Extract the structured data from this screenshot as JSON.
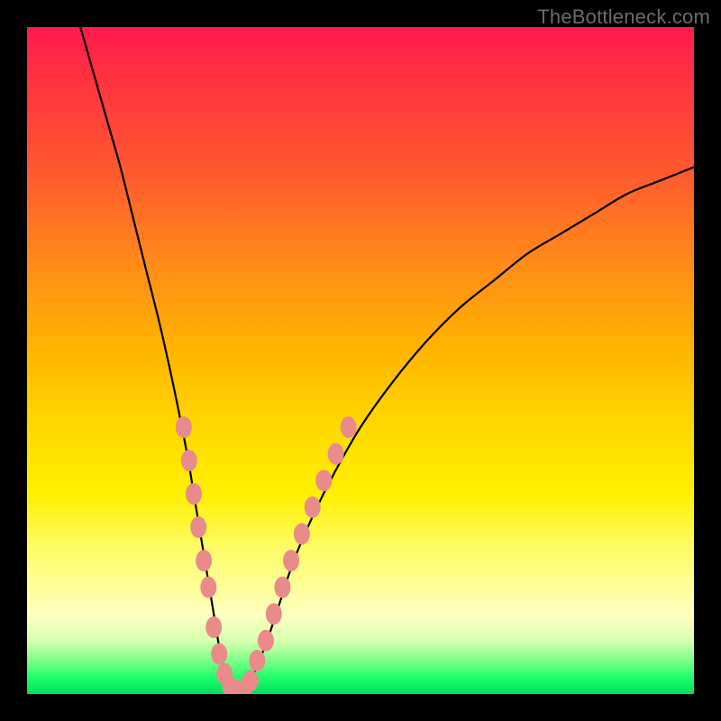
{
  "watermark": "TheBottleneck.com",
  "chart_data": {
    "type": "line",
    "title": "",
    "xlabel": "",
    "ylabel": "",
    "xlim": [
      0,
      100
    ],
    "ylim": [
      0,
      100
    ],
    "series": [
      {
        "name": "bottleneck-curve",
        "x": [
          8,
          10,
          12,
          14,
          16,
          18,
          20,
          22,
          24,
          25,
          26,
          27,
          28,
          29,
          30,
          31,
          32,
          33,
          34,
          36,
          38,
          40,
          43,
          46,
          50,
          55,
          60,
          65,
          70,
          75,
          80,
          85,
          90,
          95,
          100
        ],
        "y": [
          100,
          93,
          86,
          79,
          71,
          63,
          55,
          46,
          36,
          30,
          24,
          18,
          12,
          6,
          2,
          0,
          0,
          1,
          3,
          8,
          14,
          20,
          27,
          33,
          40,
          47,
          53,
          58,
          62,
          66,
          69,
          72,
          75,
          77,
          79
        ]
      }
    ],
    "markers": {
      "name": "highlight-dots",
      "color": "#e98b8b",
      "points": [
        {
          "x": 23.5,
          "y": 40
        },
        {
          "x": 24.3,
          "y": 35
        },
        {
          "x": 25.0,
          "y": 30
        },
        {
          "x": 25.7,
          "y": 25
        },
        {
          "x": 26.5,
          "y": 20
        },
        {
          "x": 27.2,
          "y": 16
        },
        {
          "x": 28.0,
          "y": 10
        },
        {
          "x": 28.8,
          "y": 6
        },
        {
          "x": 29.6,
          "y": 3
        },
        {
          "x": 30.5,
          "y": 1
        },
        {
          "x": 31.5,
          "y": 0.5
        },
        {
          "x": 32.5,
          "y": 0.5
        },
        {
          "x": 33.5,
          "y": 2
        },
        {
          "x": 34.5,
          "y": 5
        },
        {
          "x": 35.8,
          "y": 8
        },
        {
          "x": 37.0,
          "y": 12
        },
        {
          "x": 38.3,
          "y": 16
        },
        {
          "x": 39.6,
          "y": 20
        },
        {
          "x": 41.2,
          "y": 24
        },
        {
          "x": 42.8,
          "y": 28
        },
        {
          "x": 44.5,
          "y": 32
        },
        {
          "x": 46.3,
          "y": 36
        },
        {
          "x": 48.2,
          "y": 40
        }
      ]
    }
  }
}
